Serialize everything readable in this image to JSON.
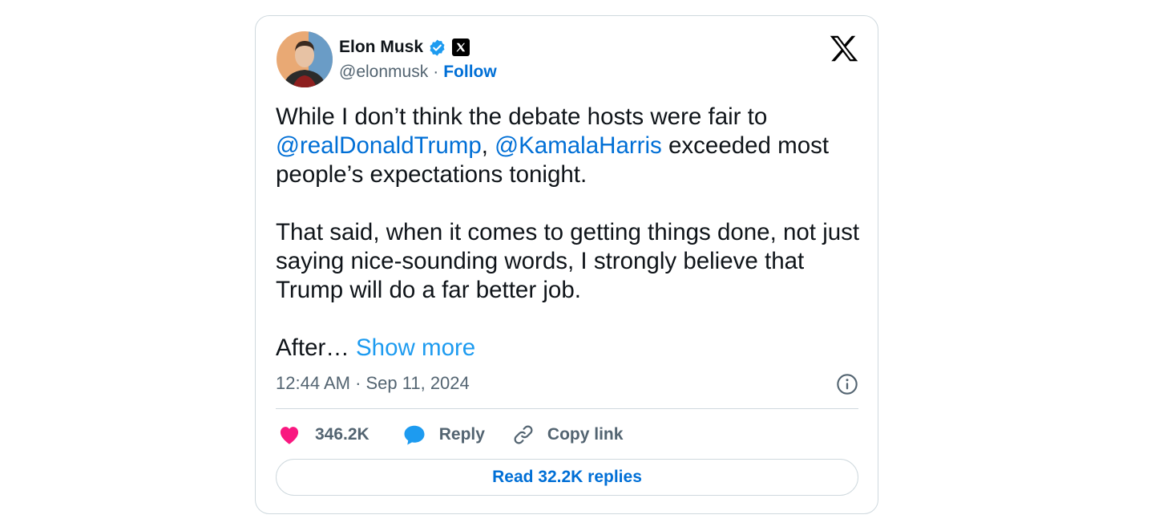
{
  "author": {
    "name": "Elon Musk",
    "handle": "@elonmusk",
    "separator": "·",
    "follow_label": "Follow"
  },
  "tweet": {
    "paragraphs": [
      {
        "line1": "While I don’t think the debate hosts were fair to",
        "mention1": "@realDonaldTrump",
        "comma": ", ",
        "mention2": "@KamalaHarris",
        "after_mention": " exceeded most people’s expectations tonight."
      },
      {
        "text": "That said, when it comes to getting things done, not just saying nice-sounding words, I strongly believe that Trump will do a far better job."
      },
      {
        "text": "After… ",
        "show_more": "Show more"
      }
    ],
    "timestamp": "12:44 AM · Sep 11, 2024"
  },
  "actions": {
    "likes": "346.2K",
    "reply_label": "Reply",
    "copy_link_label": "Copy link"
  },
  "read_replies_label": "Read 32.2K replies",
  "icons": {
    "verified": "verified-badge-icon",
    "affiliate": "x-affiliate-badge-icon",
    "brand": "x-logo-icon",
    "info": "info-icon",
    "like": "heart-icon",
    "reply": "speech-bubble-icon",
    "link": "link-icon"
  },
  "colors": {
    "link": "#006fd6",
    "show_more": "#1d9bf0",
    "heart": "#f91880",
    "reply_bubble": "#1d9bf0",
    "secondary_text": "#536471",
    "border": "#cfd9de"
  }
}
